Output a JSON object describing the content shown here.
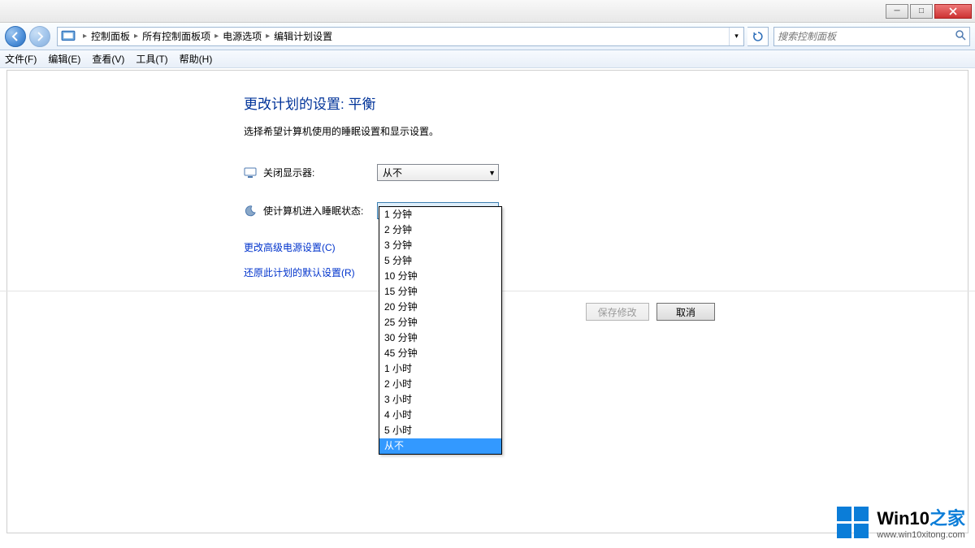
{
  "window_buttons": {
    "min": "—",
    "max": "▢",
    "close": "×"
  },
  "breadcrumb": {
    "root_icon": "control-panel-icon",
    "items": [
      "控制面板",
      "所有控制面板项",
      "电源选项",
      "编辑计划设置"
    ]
  },
  "search": {
    "placeholder": "搜索控制面板"
  },
  "menu": {
    "file": "文件(F)",
    "edit": "编辑(E)",
    "view": "查看(V)",
    "tools": "工具(T)",
    "help": "帮助(H)"
  },
  "main": {
    "title": "更改计划的设置: 平衡",
    "subtitle": "选择希望计算机使用的睡眠设置和显示设置。",
    "display_off": {
      "label": "关闭显示器:",
      "value": "从不"
    },
    "sleep": {
      "label": "使计算机进入睡眠状态:",
      "value": "从不"
    },
    "link_advanced": "更改高级电源设置(C)",
    "link_restore": "还原此计划的默认设置(R)",
    "save": "保存修改",
    "cancel": "取消"
  },
  "dropdown": {
    "options": [
      "1 分钟",
      "2 分钟",
      "3 分钟",
      "5 分钟",
      "10 分钟",
      "15 分钟",
      "20 分钟",
      "25 分钟",
      "30 分钟",
      "45 分钟",
      "1 小时",
      "2 小时",
      "3 小时",
      "4 小时",
      "5 小时",
      "从不"
    ],
    "selected": "从不"
  },
  "watermark": {
    "brand": "Win10",
    "brand_zh": "之家",
    "url": "www.win10xitong.com"
  }
}
